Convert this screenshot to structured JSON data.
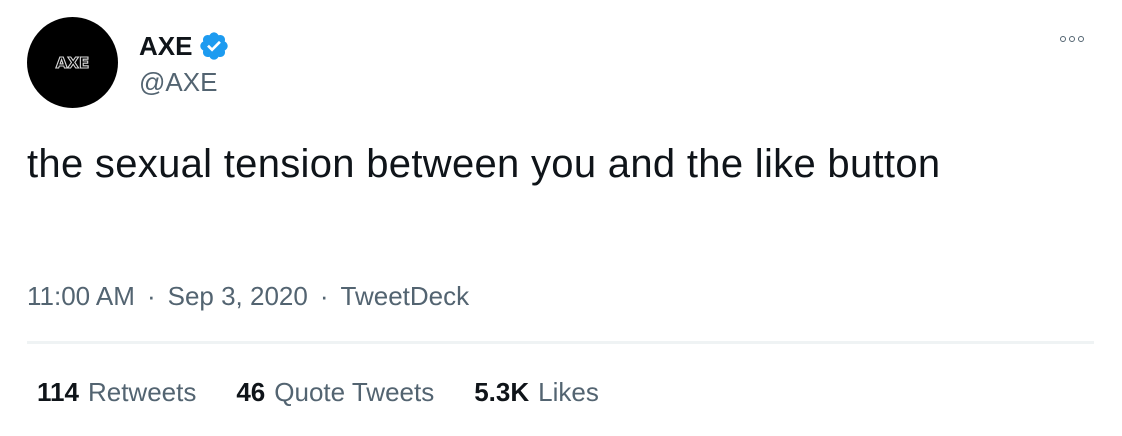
{
  "tweet": {
    "author": {
      "display_name": "AXE",
      "handle": "@AXE",
      "avatar_logo": "AXE",
      "verified": true,
      "verified_icon": "verified-badge-icon",
      "verified_color": "#1d9bf0"
    },
    "text": "the sexual tension between you and the like button",
    "meta": {
      "time": "11:00 AM",
      "separator": "·",
      "date": "Sep 3, 2020",
      "source": "TweetDeck"
    },
    "stats": {
      "retweets": {
        "count": "114",
        "label": "Retweets"
      },
      "quote_tweets": {
        "count": "46",
        "label": "Quote Tweets"
      },
      "likes": {
        "count": "5.3K",
        "label": "Likes"
      }
    },
    "more_icon": "more-options-icon"
  },
  "colors": {
    "primary_text": "#0f1419",
    "secondary_text": "#536471",
    "divider": "#eff3f4",
    "avatar_bg": "#000000"
  }
}
